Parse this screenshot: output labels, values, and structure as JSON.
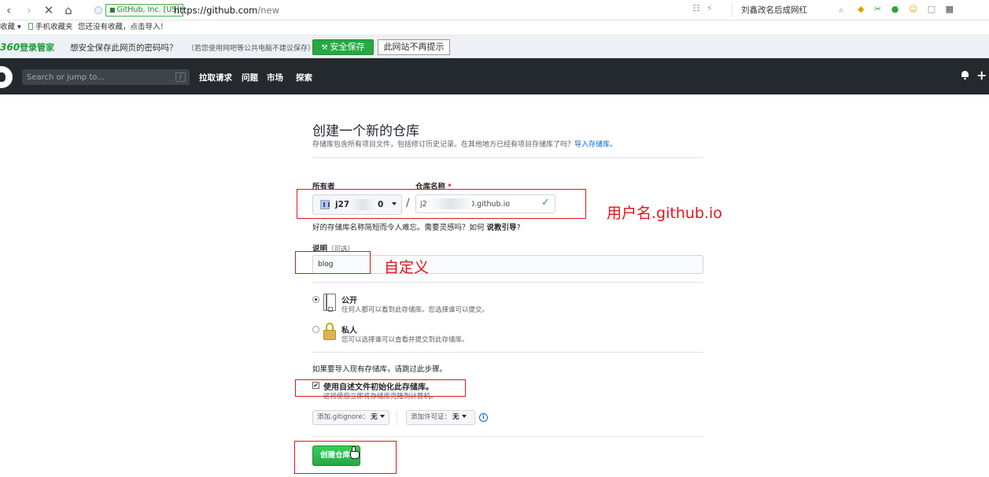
{
  "browser": {
    "cert_label": "GitHub, Inc. [US]",
    "url_main": "https://github.com",
    "url_path": "/new",
    "hot_search": "刘鑫改名后成网红",
    "bookmarks": {
      "favorites": "收藏",
      "mobile": "手机收藏夹",
      "empty_hint": "您还没有收藏，点击导入！"
    }
  },
  "password_bar": {
    "brand_num": "360",
    "brand_name": "登录管家",
    "question": "想安全保存此网页的密码吗？",
    "note": "（若您使用网吧等公共电脑不建议保存）",
    "save_label": "安全保存",
    "never_label": "此网站不再提示"
  },
  "github_header": {
    "search_placeholder": "Search or jump to...",
    "slash_key": "/",
    "nav": [
      "拉取请求",
      "问题",
      "市场",
      "探索"
    ]
  },
  "form": {
    "title": "创建一个新的仓库",
    "subtitle": "存储库包含所有项目文件，包括修订历史记录。在其他地方已经有项目存储库了吗？",
    "import_link": "导入存储库。",
    "owner_label": "所有者",
    "repo_label": "仓库名称",
    "required_mark": "*",
    "owner_name_visible_start": "j27",
    "owner_name_visible_end": "0",
    "slash": "/",
    "repo_name_value": "j2                  0.github.io",
    "name_hint": "好的存储库名称简短而令人难忘。需要灵感吗？如何",
    "name_hint_bold": "说教引导",
    "name_hint_end": "?",
    "desc_label": "说明",
    "desc_optional": "（可选）",
    "desc_value": "blog",
    "public_title": "公开",
    "public_desc": "任何人都可以看到此存储库。您选择谁可以提交。",
    "private_title": "私人",
    "private_desc": "您可以选择谁可以查看并提交到此存储库。",
    "public_selected": true,
    "import_note": "如果要导入现有存储库，请跳过此步骤。",
    "init_title": "使用自述文件初始化此存储库。",
    "init_desc": "这将使您立即将存储库克隆到计算机。",
    "init_checked": true,
    "gitignore_label": "添加.gitignore：",
    "gitignore_value": "无",
    "license_label": "添加许可证：",
    "license_value": "无",
    "create_label": "创建仓库"
  },
  "annotations": {
    "repo_name_note": "用户名.github.io",
    "desc_note": "自定义",
    "color": "#e3141b"
  }
}
